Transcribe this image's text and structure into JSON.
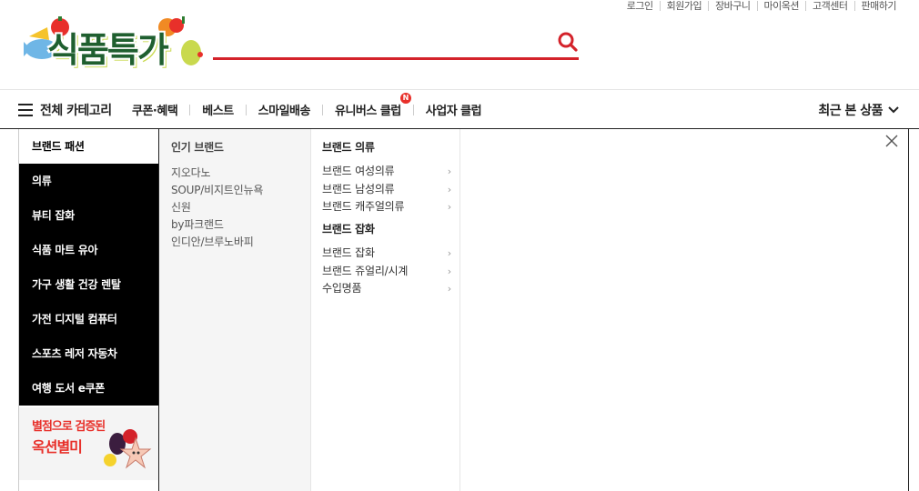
{
  "util_links": [
    "로그인",
    "회원가입",
    "장바구니",
    "마이옥션",
    "고객센터",
    "판매하기"
  ],
  "logo": {
    "text": "식품특가"
  },
  "search": {
    "value": "",
    "placeholder": ""
  },
  "nav": {
    "all_categories": "전체 카테고리",
    "menu": [
      "쿠폰·혜택",
      "베스트",
      "스마일배송",
      "유니버스 클럽",
      "사업자 클럽"
    ],
    "universe_badge": "N",
    "recent": "최근 본 상품"
  },
  "categories": [
    "브랜드 패션",
    "의류",
    "뷰티 잡화",
    "식품 마트 유아",
    "가구 생활 건강 렌탈",
    "가전 디지털 컴퓨터",
    "스포츠 레저 자동차",
    "여행 도서 e쿠폰"
  ],
  "banner": {
    "line1": "별점으로 검증된",
    "line2": "옥션별미"
  },
  "popular": {
    "heading": "인기 브랜드",
    "brands": [
      "지오다노",
      "SOUP/비지트인뉴욕",
      "신원",
      "by파크랜드",
      "인디안/브루노바피"
    ]
  },
  "subcategories": {
    "group1": {
      "title": "브랜드 의류",
      "items": [
        "브랜드 여성의류",
        "브랜드 남성의류",
        "브랜드 캐주얼의류"
      ]
    },
    "group2": {
      "title": "브랜드 잡화",
      "items": [
        "브랜드 잡화",
        "브랜드 쥬얼리/시계",
        "수입명품"
      ]
    }
  },
  "chevron_glyph": "›",
  "colors": {
    "accent": "#d4222a",
    "logo_green": "#1f5f2f",
    "category_bg": "#000000"
  }
}
